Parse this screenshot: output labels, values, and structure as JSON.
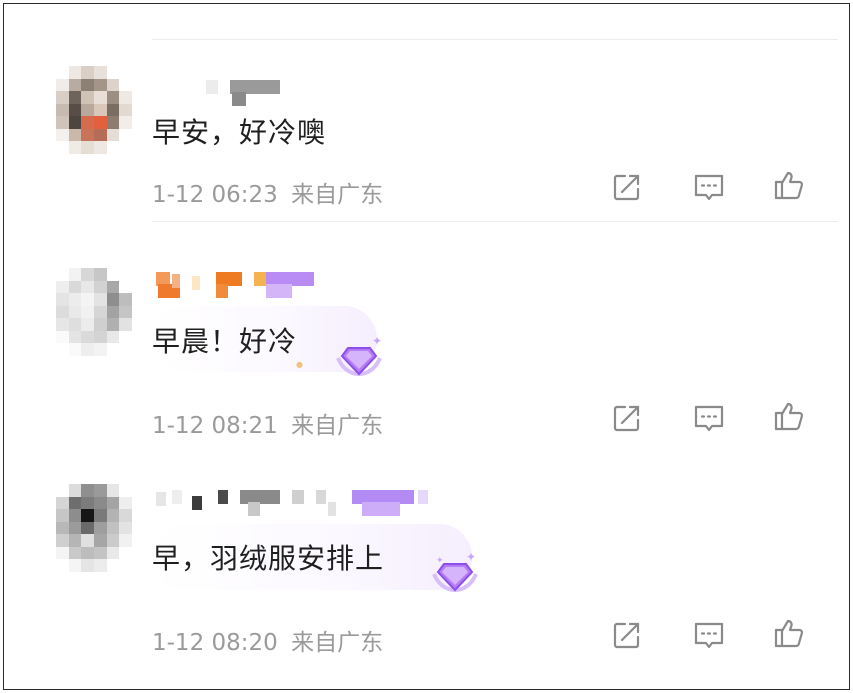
{
  "comments": [
    {
      "text": "早安，好冷噢",
      "time": "1-12 06:23",
      "location": "来自广东"
    },
    {
      "text": "早晨！好冷",
      "time": "1-12 08:21",
      "location": "来自广东"
    },
    {
      "text": "早，羽绒服安排上",
      "time": "1-12 08:20",
      "location": "来自广东"
    }
  ],
  "icons": {
    "share": "share-icon",
    "reply": "comment-icon",
    "like": "thumbs-up-icon",
    "badge": "diamond-badge-icon"
  },
  "colors": {
    "meta_text": "#9a9a9a",
    "icon_stroke": "#8a8a8a",
    "badge_purple": "#a56cf5"
  }
}
